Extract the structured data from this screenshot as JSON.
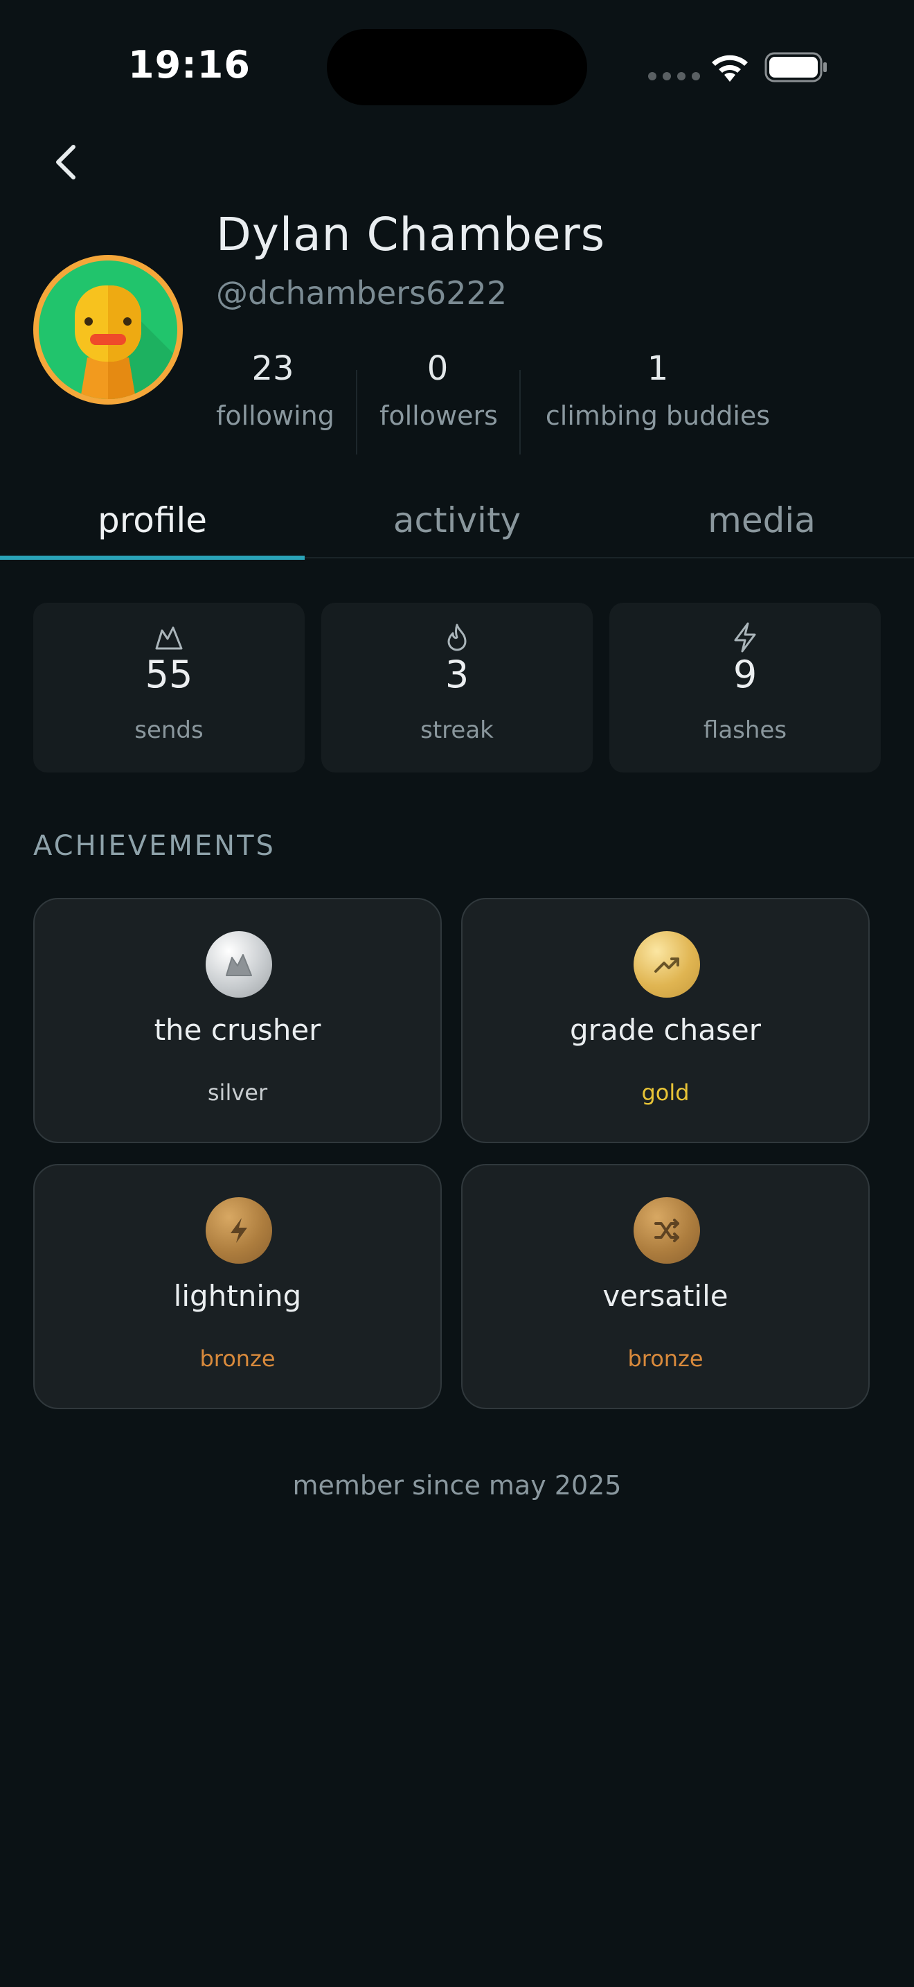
{
  "status_bar": {
    "time": "19:16"
  },
  "profile": {
    "name": "Dylan Chambers",
    "handle": "@dchambers6222",
    "stats": [
      {
        "value": "23",
        "label": "following"
      },
      {
        "value": "0",
        "label": "followers"
      },
      {
        "value": "1",
        "label": "climbing buddies"
      }
    ]
  },
  "tabs": [
    {
      "label": "profile",
      "active": true
    },
    {
      "label": "activity",
      "active": false
    },
    {
      "label": "media",
      "active": false
    }
  ],
  "summary": [
    {
      "icon": "mountain-icon",
      "value": "55",
      "label": "sends"
    },
    {
      "icon": "flame-icon",
      "value": "3",
      "label": "streak"
    },
    {
      "icon": "lightning-icon",
      "value": "9",
      "label": "flashes"
    }
  ],
  "achievements_title": "ACHIEVEMENTS",
  "achievements": [
    {
      "title": "the crusher",
      "tier": "silver",
      "icon": "mountain-icon",
      "tier_color": "#c8cdd0"
    },
    {
      "title": "grade chaser",
      "tier": "gold",
      "icon": "trending-up-icon",
      "tier_color": "#e8c437"
    },
    {
      "title": "lightning",
      "tier": "bronze",
      "icon": "lightning-icon",
      "tier_color": "#d98a3c"
    },
    {
      "title": "versatile",
      "tier": "bronze",
      "icon": "shuffle-icon",
      "tier_color": "#d98a3c"
    }
  ],
  "member_since": "member since may 2025",
  "colors": {
    "accent": "#2aa3b8",
    "background": "#0b1215",
    "card": "#151c1f"
  }
}
